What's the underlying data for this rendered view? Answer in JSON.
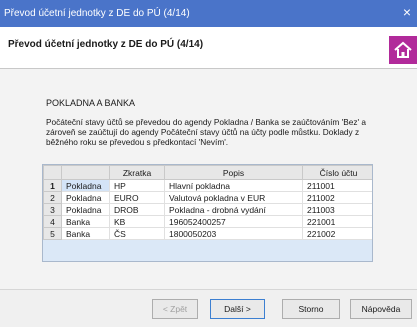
{
  "window": {
    "title": "Převod účetní jednotky z DE do PÚ (4/14)",
    "close_glyph": "×"
  },
  "header": {
    "title": "Převod účetní jednotky z DE do PÚ (4/14)",
    "icon": "home-icon"
  },
  "section": {
    "title": "POKLADNA A BANKA",
    "description": "Počáteční stavy účtů se převedou do agendy Pokladna / Banka se zaúčtováním 'Bez' a zároveň se zaúčtují do agendy Počáteční stavy účtů na účty podle můstku. Doklady z běžného roku se převedou s předkontací 'Nevím'."
  },
  "grid": {
    "columns": [
      "",
      "",
      "Zkratka",
      "Popis",
      "Číslo účtu"
    ],
    "rows": [
      {
        "n": "1",
        "type": "Pokladna",
        "zkratka": "HP",
        "popis": "Hlavní pokladna",
        "ucet": "211001",
        "selected": true
      },
      {
        "n": "2",
        "type": "Pokladna",
        "zkratka": "EURO",
        "popis": "Valutová pokladna v EUR",
        "ucet": "211002"
      },
      {
        "n": "3",
        "type": "Pokladna",
        "zkratka": "DROB",
        "popis": "Pokladna - drobná vydání",
        "ucet": "211003"
      },
      {
        "n": "4",
        "type": "Banka",
        "zkratka": "KB",
        "popis": "196052400257",
        "ucet": "221001"
      },
      {
        "n": "5",
        "type": "Banka",
        "zkratka": "ČS",
        "popis": "1800050203",
        "ucet": "221002"
      }
    ]
  },
  "footer": {
    "back": "< Zpět",
    "next": "Další >",
    "cancel": "Storno",
    "help": "Nápověda"
  }
}
